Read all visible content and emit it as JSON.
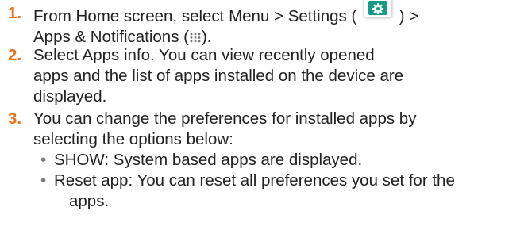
{
  "steps": [
    {
      "number": "1.",
      "line1_a": "From Home screen, select Menu > Settings (",
      "line1_b": ") >",
      "line2_a": "Apps & Notifications (",
      "line2_b": ").",
      "icons": [
        "settings-gear-icon",
        "apps-grid-icon"
      ]
    },
    {
      "number": "2.",
      "lines": [
        "Select Apps info. You can view recently opened",
        "apps and the list of apps installed on the device are",
        "displayed."
      ]
    },
    {
      "number": "3.",
      "lines": [
        "You can change the preferences for installed apps by",
        "selecting the options below:"
      ],
      "bullets": [
        {
          "text": "SHOW: System based apps are displayed."
        },
        {
          "text": "Reset app: You can reset all preferences you set for the",
          "cont": "apps."
        }
      ]
    }
  ],
  "colors": {
    "step_number": "#e8711e",
    "settings_icon_bg": "#189b84",
    "bullet": "#7a7a7a"
  }
}
